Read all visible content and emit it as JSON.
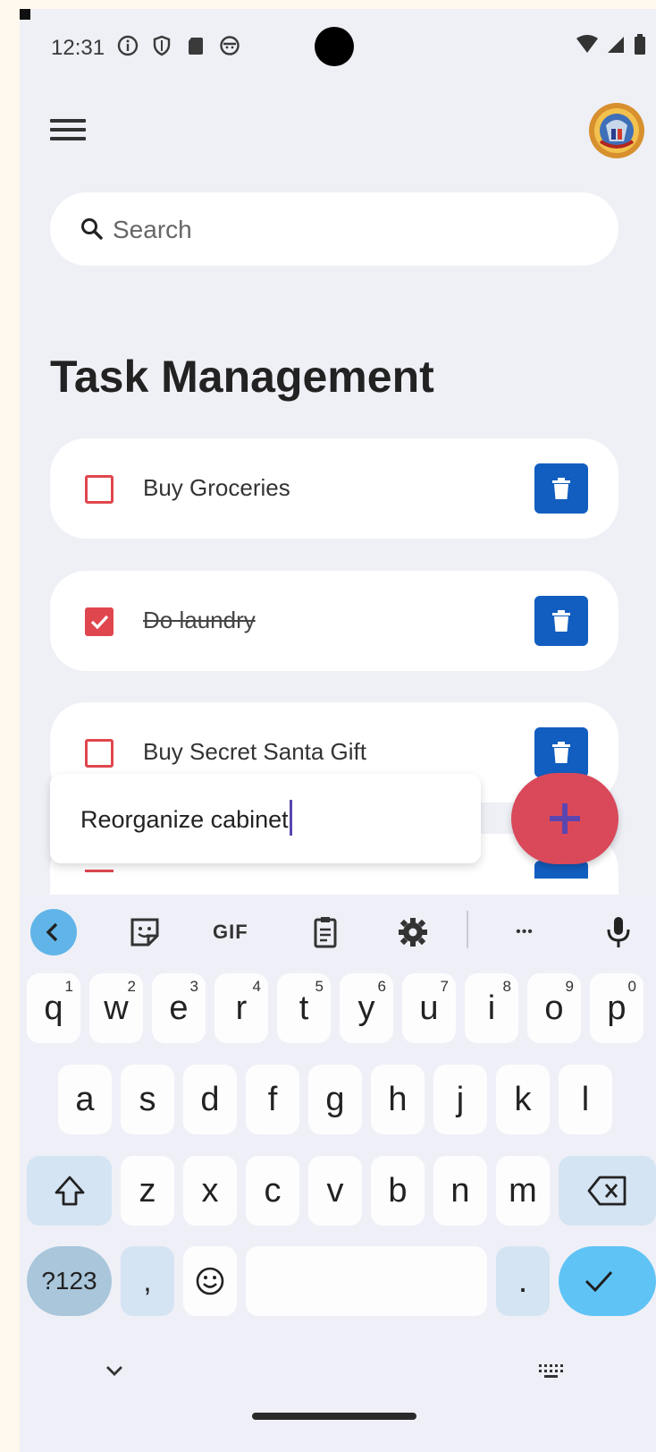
{
  "status_bar": {
    "time": "12:31"
  },
  "search": {
    "placeholder": "Search"
  },
  "page": {
    "title": "Task Management"
  },
  "tasks": [
    {
      "label": "Buy Groceries",
      "done": false
    },
    {
      "label": "Do laundry",
      "done": true
    },
    {
      "label": "Buy Secret Santa Gift",
      "done": false
    }
  ],
  "new_task_input": {
    "value": "Reorganize cabinet"
  },
  "keyboard": {
    "row1": [
      {
        "key": "q",
        "hint": "1"
      },
      {
        "key": "w",
        "hint": "2"
      },
      {
        "key": "e",
        "hint": "3"
      },
      {
        "key": "r",
        "hint": "4"
      },
      {
        "key": "t",
        "hint": "5"
      },
      {
        "key": "y",
        "hint": "6"
      },
      {
        "key": "u",
        "hint": "7"
      },
      {
        "key": "i",
        "hint": "8"
      },
      {
        "key": "o",
        "hint": "9"
      },
      {
        "key": "p",
        "hint": "0"
      }
    ],
    "row2": [
      "a",
      "s",
      "d",
      "f",
      "g",
      "h",
      "j",
      "k",
      "l"
    ],
    "row3": [
      "z",
      "x",
      "c",
      "v",
      "b",
      "n",
      "m"
    ],
    "symbols_label": "?123",
    "comma": ",",
    "period": ".",
    "gif_label": "GIF",
    "more_label": "•••"
  },
  "colors": {
    "accent_red": "#e0464e",
    "delete_blue": "#125ec0",
    "fab_red": "#d9495a",
    "fab_plus": "#5b46b0"
  },
  "icons": [
    "menu-icon",
    "search-icon",
    "trash-icon",
    "plus-icon",
    "sticker-icon",
    "clipboard-icon",
    "gear-icon",
    "mic-icon",
    "backspace-icon",
    "shift-icon",
    "emoji-icon",
    "check-icon",
    "chevron-down-icon",
    "keyboard-icon"
  ]
}
